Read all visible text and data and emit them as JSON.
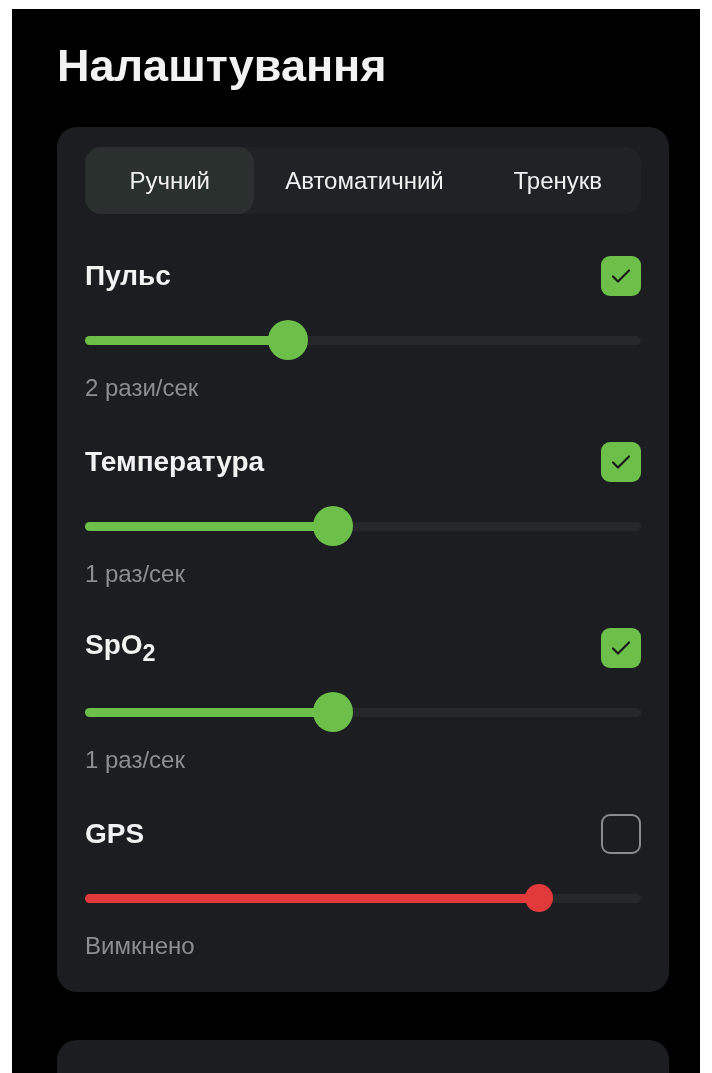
{
  "title": "Налаштування",
  "tabs": [
    {
      "label": "Ручний",
      "selected": true
    },
    {
      "label": "Автоматичний",
      "selected": false
    },
    {
      "label": "Тренукв",
      "selected": false
    }
  ],
  "sensors": [
    {
      "name": "Пульс",
      "checked": true,
      "level": 0.365,
      "reading": "2 рази/сек"
    },
    {
      "name": "Температура",
      "checked": true,
      "level": 0.446,
      "reading": "1 раз/сек"
    },
    {
      "name": "SpO$_{2}$",
      "checked": true,
      "level": 0.446,
      "reading": "1 раз/сек"
    },
    {
      "name": "GPS",
      "checked": false,
      "level": 0.817,
      "reading": "Вимкнено"
    }
  ]
}
